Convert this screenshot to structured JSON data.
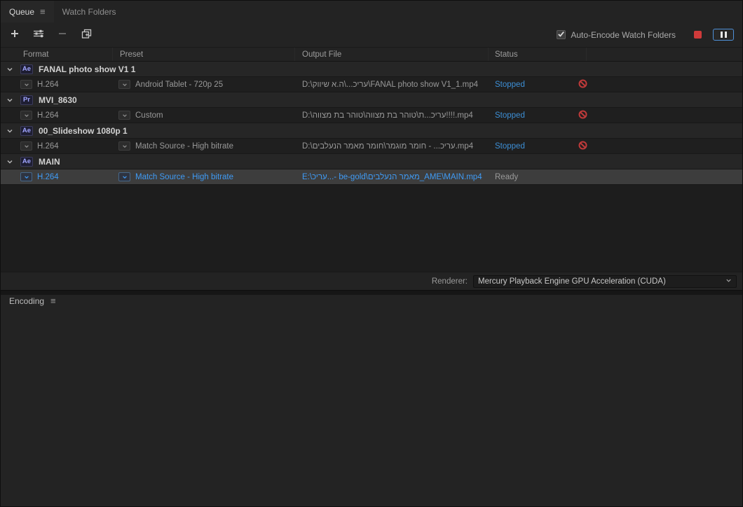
{
  "panel": {
    "tabs": [
      {
        "label": "Queue",
        "active": true
      },
      {
        "label": "Watch Folders",
        "active": false
      }
    ],
    "bottom_tab_label": "Encoding"
  },
  "toolbar": {
    "auto_encode": {
      "label": "Auto-Encode Watch Folders",
      "checked": true
    }
  },
  "columns": [
    {
      "label": "Format"
    },
    {
      "label": "Preset"
    },
    {
      "label": "Output File"
    },
    {
      "label": "Status"
    }
  ],
  "queue": {
    "groups": [
      {
        "app_badge": "Ae",
        "name": "FANAL photo show V1 1",
        "items": [
          {
            "format": "H.264",
            "preset": "Android Tablet - 720p 25",
            "output_file": "D:\\עריכ...\\ה.א שיווק\\FANAL photo show V1_1.mp4",
            "status": "Stopped",
            "error": true,
            "selected": false
          }
        ]
      },
      {
        "app_badge": "Pr",
        "name": "MVI_8630",
        "items": [
          {
            "format": "H.264",
            "preset": "Custom",
            "output_file": "D:\\עריכ...ת\\טוהר בת מצווה\\טוהר בת מצווה!!!!.mp4",
            "status": "Stopped",
            "error": true,
            "selected": false
          }
        ]
      },
      {
        "app_badge": "Ae",
        "name": "00_Slideshow 1080p 1",
        "items": [
          {
            "format": "H.264",
            "preset": "Match Source - High bitrate",
            "output_file": "D:\\עריכ... - חומר מוגמר\\חומר מאמר הנעלבים.mp4",
            "status": "Stopped",
            "error": true,
            "selected": false
          }
        ]
      },
      {
        "app_badge": "Ae",
        "name": "MAIN",
        "items": [
          {
            "format": "H.264",
            "preset": "Match Source - High bitrate",
            "output_file": "E:\\עריכ...- be-gold\\מאמר הנעלבים_AME\\MAIN.mp4",
            "status": "Ready",
            "error": false,
            "selected": true
          }
        ]
      }
    ]
  },
  "renderer": {
    "label": "Renderer:",
    "value": "Mercury Playback Engine GPU Acceleration (CUDA)"
  },
  "colors": {
    "status_stopped": "#3d8fd6",
    "status_ready": "#9a9a9a",
    "selected_text": "#3f9bf5",
    "error_icon": "#c03a3a",
    "stop_button": "#cf3a3a",
    "pause_button_border": "#4e90d8",
    "badge_text": "#a0a5ff"
  }
}
